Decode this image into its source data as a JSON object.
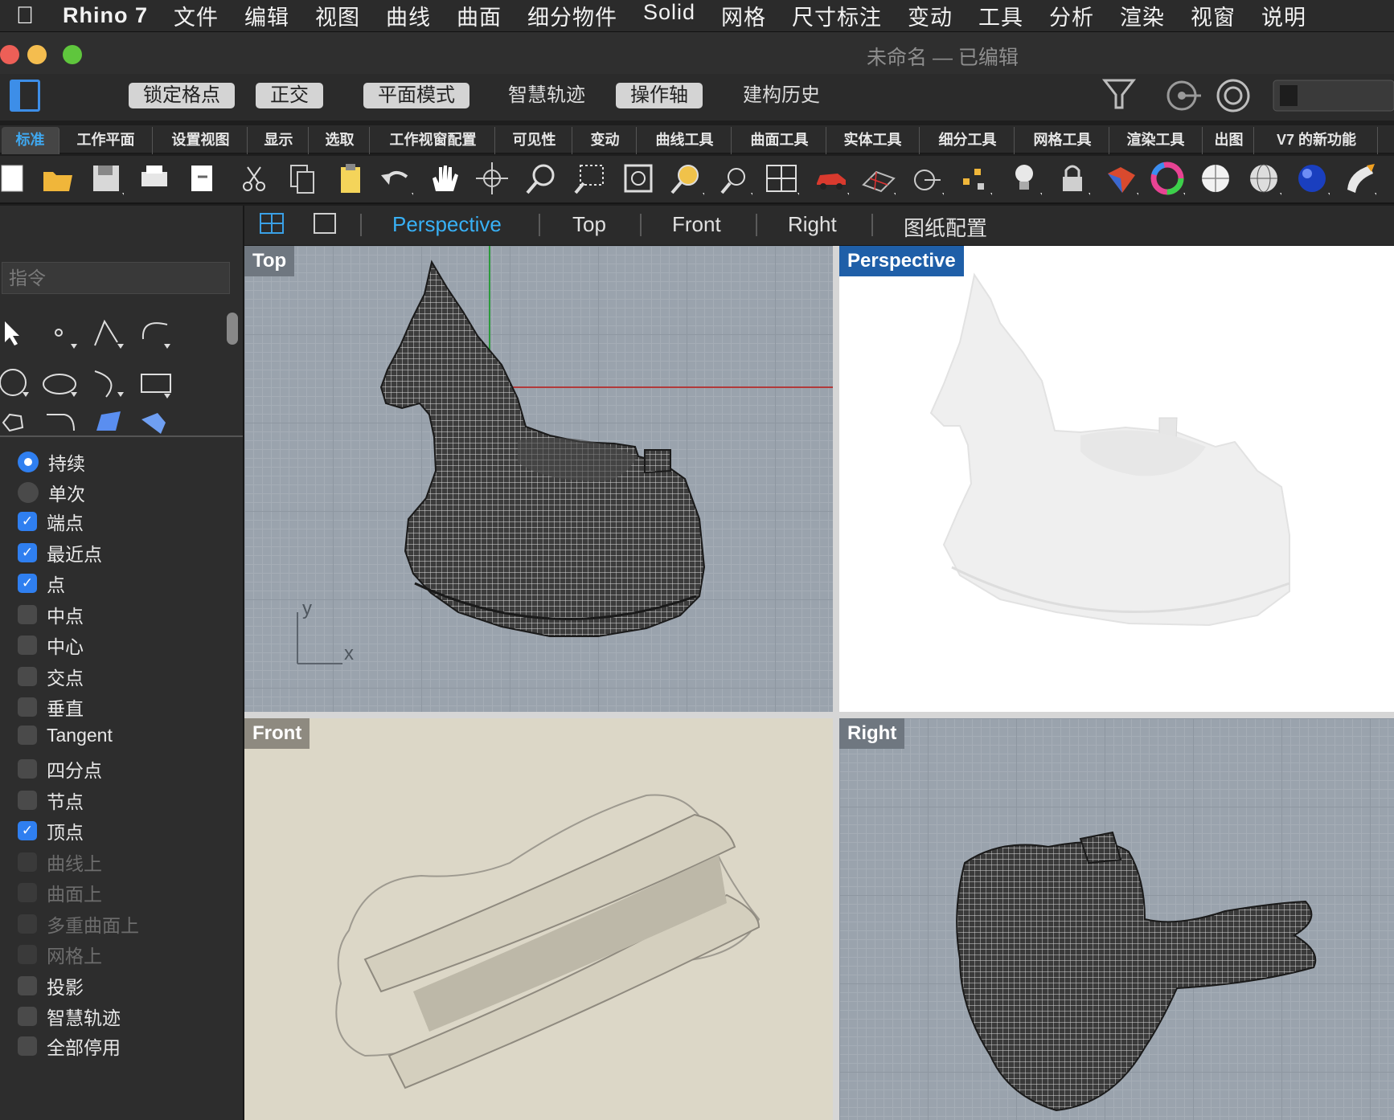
{
  "menubar": {
    "app_name": "Rhino 7",
    "items": [
      "文件",
      "编辑",
      "视图",
      "曲线",
      "曲面",
      "细分物件",
      "Solid",
      "网格",
      "尺寸标注",
      "变动",
      "工具",
      "分析",
      "渲染",
      "视窗",
      "说明"
    ]
  },
  "window": {
    "title": "未命名 — 已编辑"
  },
  "modebar": {
    "buttons": [
      {
        "label": "锁定格点",
        "on": true
      },
      {
        "label": "正交",
        "on": true
      },
      {
        "label": "平面模式",
        "on": true
      },
      {
        "label": "智慧轨迹",
        "on": false
      },
      {
        "label": "操作轴",
        "on": true
      },
      {
        "label": "建构历史",
        "on": false
      }
    ]
  },
  "toolbar_tabs": [
    "标准",
    "工作平面",
    "设置视图",
    "显示",
    "选取",
    "工作视窗配置",
    "可见性",
    "变动",
    "曲线工具",
    "曲面工具",
    "实体工具",
    "细分工具",
    "网格工具",
    "渲染工具",
    "出图",
    "V7 的新功能"
  ],
  "toolbar_icons": [
    "new-file-icon",
    "open-folder-icon",
    "save-icon",
    "print-icon",
    "import-icon",
    "cut-icon",
    "copy-icon",
    "paste-icon",
    "undo-icon",
    "pan-hand-icon",
    "rotate-view-icon",
    "zoom-icon",
    "zoom-window-icon",
    "zoom-extents-icon",
    "zoom-selected-icon",
    "undo-view-icon",
    "four-viewports-icon",
    "car-icon",
    "grid-plane-icon",
    "cplane-icon",
    "points-icon",
    "light-icon",
    "lock-icon",
    "material-icon",
    "color-wheel-icon",
    "shaded-sphere-icon",
    "wire-sphere-icon",
    "blue-sphere-icon",
    "render-icon"
  ],
  "command": {
    "placeholder": "指令"
  },
  "osnaps": {
    "persistence": [
      {
        "label": "持续",
        "checked": true
      },
      {
        "label": "单次",
        "checked": false
      }
    ],
    "items": [
      {
        "label": "端点",
        "checked": true,
        "disabled": false
      },
      {
        "label": "最近点",
        "checked": true,
        "disabled": false
      },
      {
        "label": "点",
        "checked": true,
        "disabled": false
      },
      {
        "label": "中点",
        "checked": false,
        "disabled": false
      },
      {
        "label": "中心",
        "checked": false,
        "disabled": false
      },
      {
        "label": "交点",
        "checked": false,
        "disabled": false
      },
      {
        "label": "垂直",
        "checked": false,
        "disabled": false
      },
      {
        "label": "Tangent",
        "checked": false,
        "disabled": false
      },
      {
        "label": "四分点",
        "checked": false,
        "disabled": false
      },
      {
        "label": "节点",
        "checked": false,
        "disabled": false
      },
      {
        "label": "顶点",
        "checked": true,
        "disabled": false
      },
      {
        "label": "曲线上",
        "checked": false,
        "disabled": true
      },
      {
        "label": "曲面上",
        "checked": false,
        "disabled": true
      },
      {
        "label": "多重曲面上",
        "checked": false,
        "disabled": true
      },
      {
        "label": "网格上",
        "checked": false,
        "disabled": true
      },
      {
        "label": "投影",
        "checked": false,
        "disabled": false
      },
      {
        "label": "智慧轨迹",
        "checked": false,
        "disabled": false
      }
    ],
    "disable_all": {
      "label": "全部停用",
      "checked": false
    }
  },
  "viewport_tabs": {
    "active": "Perspective",
    "tabs": [
      "Perspective",
      "Top",
      "Front",
      "Right",
      "图纸配置"
    ]
  },
  "viewports": {
    "top": {
      "label": "Top",
      "axis_y": "y",
      "axis_x": "x"
    },
    "perspective": {
      "label": "Perspective"
    },
    "front": {
      "label": "Front"
    },
    "right": {
      "label": "Right"
    }
  },
  "colors": {
    "accent": "#38b0f5",
    "active_label_bg": "#1f5fa8",
    "checkbox_on": "#2f7ff0"
  }
}
